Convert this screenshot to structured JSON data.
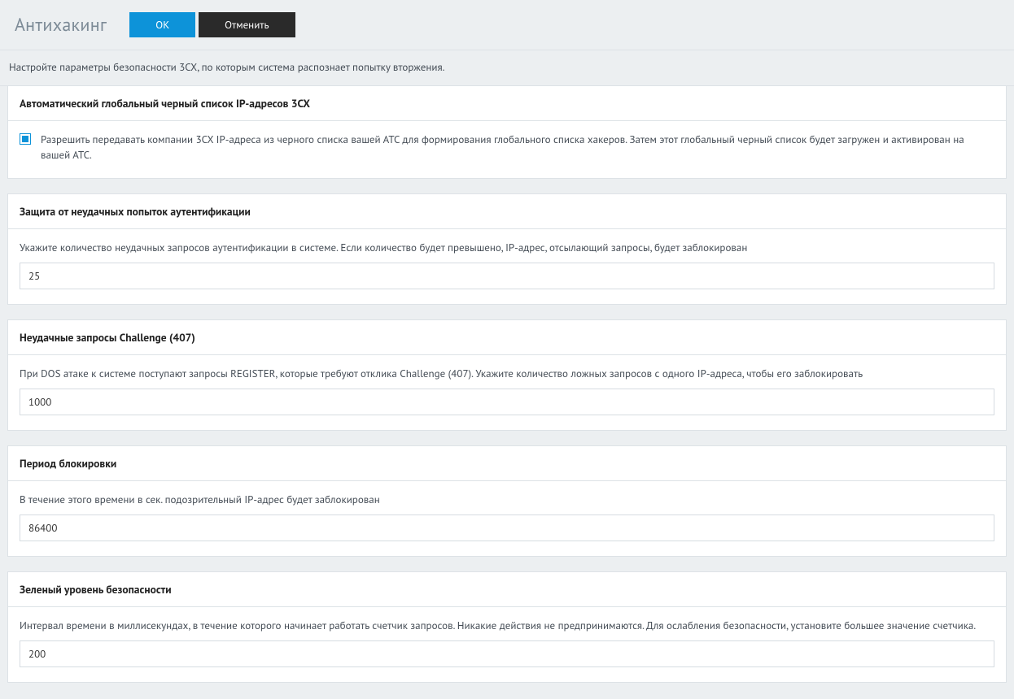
{
  "header": {
    "title": "Антихакинг",
    "ok_label": "ОК",
    "cancel_label": "Отменить"
  },
  "intro": "Настройте параметры безопасности 3CX, по которым система распознает попытку вторжения.",
  "sections": {
    "blacklist": {
      "title": "Автоматический глобальный черный список IP-адресов 3CX",
      "checkbox": {
        "checked": true,
        "label": "Разрешить передавать компании 3CX IP-адреса из черного списка вашей АТС для формирования глобального списка хакеров. Затем этот глобальный черный список будет загружен и активирован на вашей АТС."
      }
    },
    "failed_auth": {
      "title": "Защита от неудачных попыток аутентификации",
      "desc": "Укажите количество неудачных запросов аутентификации в системе. Если количество будет превышено, IP-адрес, отсылающий запросы, будет заблокирован",
      "value": "25"
    },
    "challenge": {
      "title": "Неудачные запросы Challenge (407)",
      "desc": "При DOS атаке к системе поступают запросы REGISTER, которые требуют отклика Challenge (407). Укажите количество ложных запросов с одного IP-адреса, чтобы его заблокировать",
      "value": "1000"
    },
    "block_period": {
      "title": "Период блокировки",
      "desc": "В течение этого времени в сек. подозрительный IP-адрес будет заблокирован",
      "value": "86400"
    },
    "green_level": {
      "title": "Зеленый уровень безопасности",
      "desc": "Интервал времени в миллисекундах, в течение которого начинает работать счетчик запросов. Никакие действия не предпринимаются. Для ослабления безопасности, установите большее значение счетчика.",
      "value": "200"
    }
  }
}
